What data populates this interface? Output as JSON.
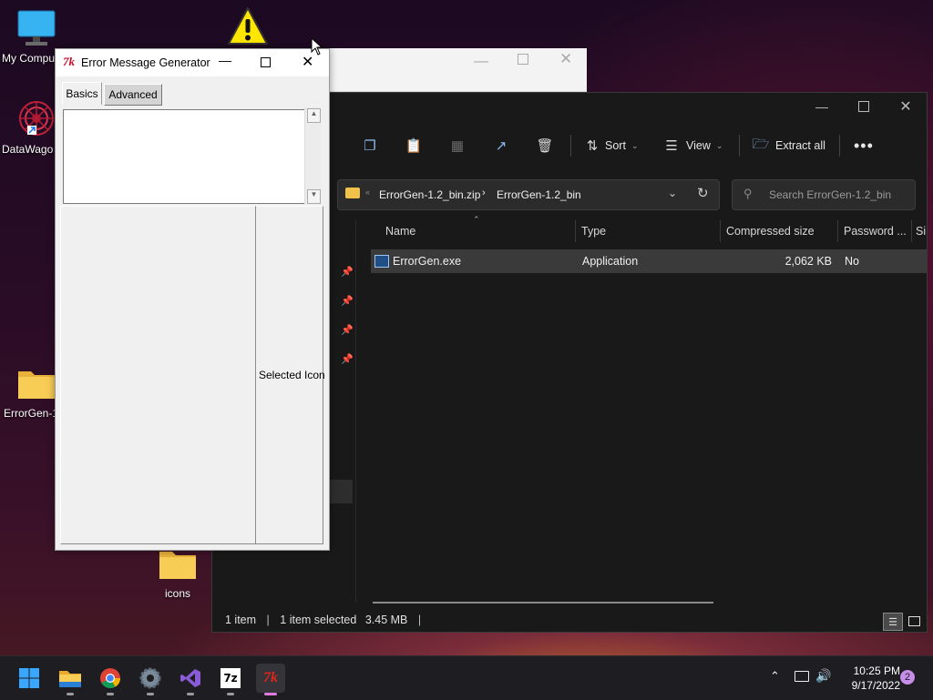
{
  "desktop": {
    "icons": [
      {
        "label": "My Compu",
        "icon": "computer-icon"
      },
      {
        "label": "DataWago",
        "icon": "datawagon-icon"
      },
      {
        "label": "ErrorGen-1",
        "icon": "folder-icon"
      },
      {
        "label": "icons",
        "icon": "folder-icon"
      }
    ]
  },
  "error_generator": {
    "title": "Error Message Generator",
    "tabs": [
      "Basics",
      "Advanced"
    ],
    "selected_icon_label": "Selected Icon"
  },
  "explorer": {
    "toolbar": {
      "sort": "Sort",
      "view": "View",
      "extract_all": "Extract all"
    },
    "address": {
      "segment1": "ErrorGen-1.2_bin.zip",
      "segment2": "ErrorGen-1.2_bin"
    },
    "search_placeholder": "Search ErrorGen-1.2_bin",
    "columns": [
      "Name",
      "Type",
      "Compressed size",
      "Password ...",
      "Si"
    ],
    "rows": [
      {
        "name": "ErrorGen.exe",
        "type": "Application",
        "compressed_size": "2,062 KB",
        "password": "No"
      }
    ],
    "status": {
      "count": "1 item",
      "selected": "1 item selected",
      "size": "3.45 MB"
    }
  },
  "taskbar": {
    "apps": [
      "start-icon",
      "file-explorer-icon",
      "chrome-icon",
      "settings-icon",
      "visual-studio-icon",
      "7zip-icon",
      "tk-app-icon"
    ],
    "time": "10:25 PM",
    "date": "9/17/2022",
    "notifications": "2"
  },
  "colors": {
    "accent": "#0078d4",
    "explorer_bg": "#191919",
    "taskbar_bg": "#1d1d22"
  }
}
